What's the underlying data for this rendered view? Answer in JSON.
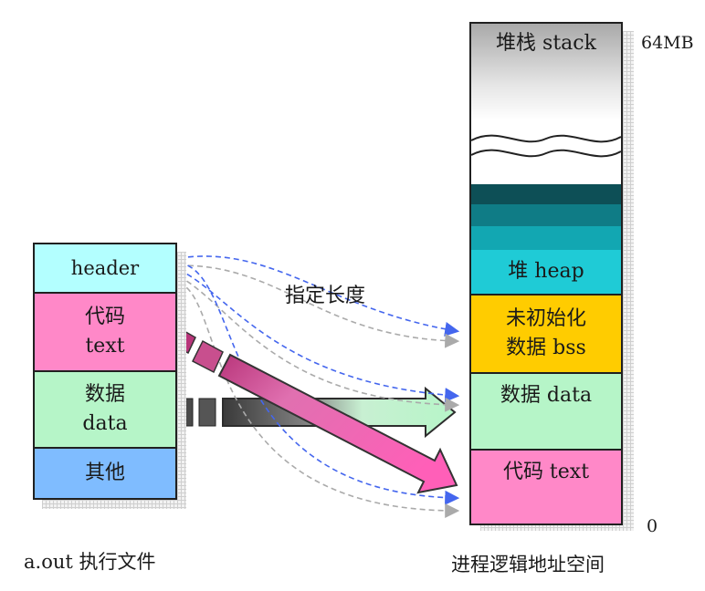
{
  "file": {
    "segments": [
      {
        "line1": "header",
        "line2": "",
        "color": "#b3ffff"
      },
      {
        "line1": "代码",
        "line2": "text",
        "color": "#ff88c8"
      },
      {
        "line1": "数据",
        "line2": "data",
        "color": "#b6f5c8"
      },
      {
        "line1": "其他",
        "line2": "",
        "color": "#7fbcff"
      }
    ],
    "caption": "a.out 执行文件"
  },
  "memory": {
    "segments": [
      {
        "line1": "堆栈 stack",
        "line2": ""
      },
      {
        "line1": "堆 heap",
        "line2": "",
        "color": "#1fcbd6"
      },
      {
        "line1": "未初始化",
        "line2": "数据 bss",
        "color": "#ffcc00"
      },
      {
        "line1": "数据 data",
        "line2": "",
        "color": "#b6f5c8"
      },
      {
        "line1": "代码 text",
        "line2": "",
        "color": "#ff88c8"
      }
    ],
    "top_label": "64MB",
    "bottom_label": "0",
    "caption": "进程逻辑地址空间"
  },
  "annotation": "指定长度",
  "colors": {
    "dashed_arrow": "#4466ee",
    "gray_dashed_arrow": "#aaaaaa",
    "text_arrow": "#ff5fb8",
    "data_arrow": "#b6f5c8",
    "heap_bands": [
      "#0d4f56",
      "#0f7c86",
      "#12a7b2",
      "#1fcbd6"
    ]
  }
}
